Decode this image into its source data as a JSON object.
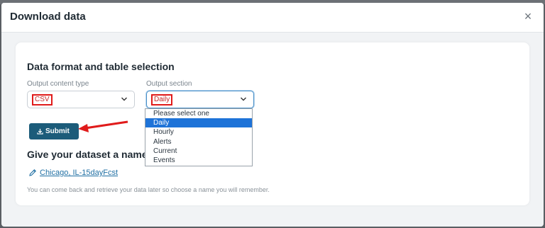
{
  "dialog": {
    "title": "Download data",
    "close_symbol": "×"
  },
  "format_section": {
    "title": "Data format and table selection",
    "content_type": {
      "label": "Output content type",
      "value": "CSV"
    },
    "output_section": {
      "label": "Output section",
      "value": "Daily",
      "options": [
        "Please select one",
        "Daily",
        "Hourly",
        "Alerts",
        "Current",
        "Events"
      ],
      "selected_index": 1
    },
    "submit_label": "Submit"
  },
  "name_section": {
    "title": "Give your dataset a name",
    "dataset_name": "Chicago, IL-15dayFcst",
    "hint": "You can come back and retrieve your data later so choose a name you will remember."
  },
  "colors": {
    "accent_button": "#1c5c7a",
    "annotation_red": "#e01b1b",
    "selected_option": "#1e73d8",
    "link": "#1f6fa3"
  },
  "icons": {
    "close": "close-icon",
    "chevron": "chevron-down-icon",
    "download": "download-icon",
    "edit": "pencil-icon"
  }
}
